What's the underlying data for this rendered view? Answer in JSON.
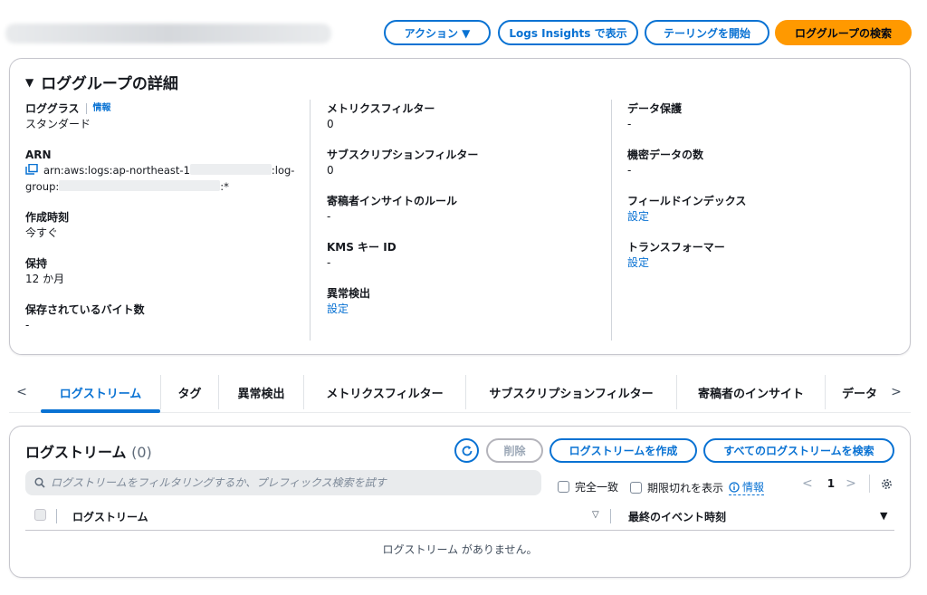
{
  "header": {
    "actions_label": "アクション ▼",
    "logs_insights_label": "Logs Insights で表示",
    "tailing_label": "テーリングを開始",
    "search_log_groups_label": "ロググループの検索"
  },
  "details": {
    "title": "ロググループの詳細",
    "log_class_label": "ロググラス",
    "info_label": "情報",
    "log_class_value": "スタンダード",
    "arn_label": "ARN",
    "arn_part1": "arn:aws:logs:ap-northeast-1",
    "arn_part2": ":log-",
    "arn_part3": "group:",
    "arn_part4": ":*",
    "created_label": "作成時刻",
    "created_value": "今すぐ",
    "retention_label": "保持",
    "retention_value": "12 か月",
    "stored_bytes_label": "保存されているバイト数",
    "stored_bytes_value": "-",
    "metric_filters_label": "メトリクスフィルター",
    "metric_filters_value": "0",
    "subscription_filters_label": "サブスクリプションフィルター",
    "subscription_filters_value": "0",
    "contributor_rules_label": "寄稿者インサイトのルール",
    "contributor_rules_value": "-",
    "kms_label": "KMS キー ID",
    "kms_value": "-",
    "anomaly_label": "異常検出",
    "anomaly_value": "設定",
    "data_protection_label": "データ保護",
    "data_protection_value": "-",
    "sensitive_count_label": "機密データの数",
    "sensitive_count_value": "-",
    "field_index_label": "フィールドインデックス",
    "field_index_value": "設定",
    "transformer_label": "トランスフォーマー",
    "transformer_value": "設定"
  },
  "tabs": {
    "prev": "<",
    "next": ">",
    "items": [
      "ログストリーム",
      "タグ",
      "異常検出",
      "メトリクスフィルター",
      "サブスクリプションフィルター",
      "寄稿者のインサイト",
      "データ"
    ]
  },
  "streams": {
    "title": "ログストリーム",
    "count": "(0)",
    "delete_label": "削除",
    "create_label": "ログストリームを作成",
    "search_all_label": "すべてのログストリームを検索",
    "search_placeholder": "ログストリームをフィルタリングするか、プレフィックス検索を試す",
    "exact_match_label": "完全一致",
    "show_expired_label": "期限切れを表示",
    "info_label": "情報",
    "page_prev": "<",
    "page_number": "1",
    "page_next": ">",
    "col_stream": "ログストリーム",
    "col_last_event": "最終のイベント時刻",
    "empty_message": "ログストリーム がありません。"
  },
  "colors": {
    "accent": "#0972d3",
    "primary_button": "#ff9900"
  }
}
